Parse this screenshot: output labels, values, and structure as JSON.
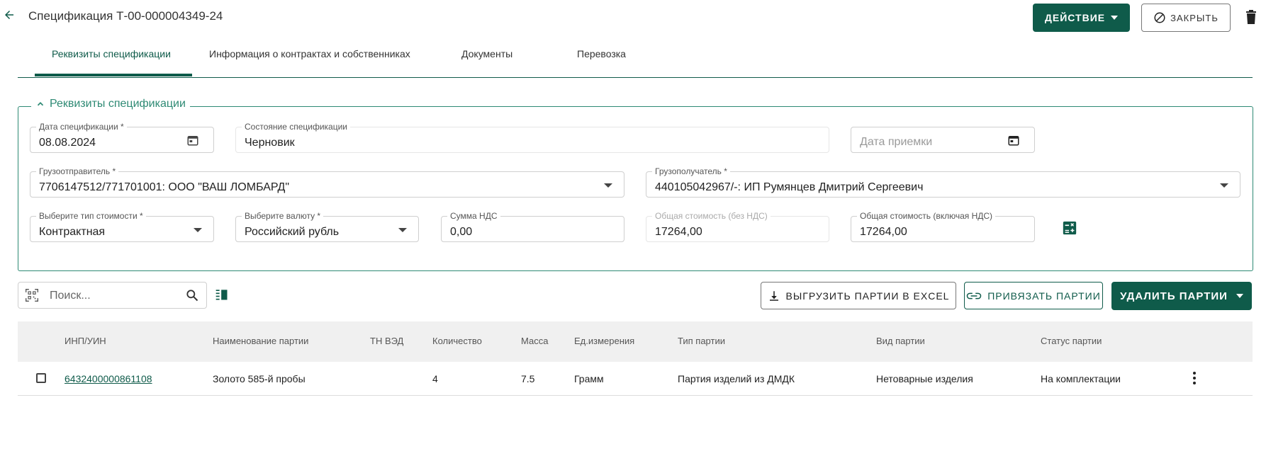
{
  "header": {
    "title": "Спецификация Т-00-000004349-24",
    "action_button": "ДЕЙСТВИЕ",
    "close_button": "ЗАКРЫТЬ"
  },
  "tabs": [
    {
      "label": "Реквизиты спецификации",
      "active": true
    },
    {
      "label": "Информация о контрактах и собственниках",
      "active": false
    },
    {
      "label": "Документы",
      "active": false
    },
    {
      "label": "Перевозка",
      "active": false
    }
  ],
  "section": {
    "title": "Реквизиты спецификации",
    "fields": {
      "spec_date": {
        "label": "Дата спецификации *",
        "value": "08.08.2024"
      },
      "spec_state": {
        "label": "Состояние спецификации",
        "value": "Черновик"
      },
      "accept_date": {
        "placeholder": "Дата приемки"
      },
      "shipper": {
        "label": "Грузоотправитель *",
        "value": "7706147512/771701001: ООО \"ВАШ ЛОМБАРД\""
      },
      "consignee": {
        "label": "Грузополучатель *",
        "value": "440105042967/-: ИП Румянцев Дмитрий Сергеевич"
      },
      "cost_type": {
        "label": "Выберите тип стоимости *",
        "value": "Контрактная"
      },
      "currency": {
        "label": "Выберите валюту *",
        "value": "Российский рубль"
      },
      "vat_sum": {
        "label": "Сумма НДС",
        "value": "0,00"
      },
      "total_no_vat": {
        "label": "Общая стоимость (без НДС)",
        "value": "17264,00"
      },
      "total_with_vat": {
        "label": "Общая стоимость (включая НДС)",
        "value": "17264,00"
      }
    }
  },
  "toolbar": {
    "search_placeholder": "Поиск...",
    "export_button": "ВЫГРУЗИТЬ ПАРТИИ В EXCEL",
    "link_button": "ПРИВЯЗАТЬ ПАРТИИ",
    "delete_button": "УДАЛИТЬ ПАРТИИ"
  },
  "table": {
    "columns": [
      "ИНП/УИН",
      "Наименование партии",
      "ТН ВЭД",
      "Количество",
      "Масса",
      "Ед.измерения",
      "Тип партии",
      "Вид партии",
      "Статус партии"
    ],
    "rows": [
      {
        "id": "6432400000861108",
        "name": "Золото 585-й пробы",
        "tnved": "",
        "quantity": "4",
        "mass": "7.5",
        "unit": "Грамм",
        "type": "Партия изделий из ДМДК",
        "kind": "Нетоварные изделия",
        "status": "На комплектации"
      }
    ]
  },
  "colors": {
    "primary": "#0f5b4a",
    "accent": "#2e8a74"
  }
}
